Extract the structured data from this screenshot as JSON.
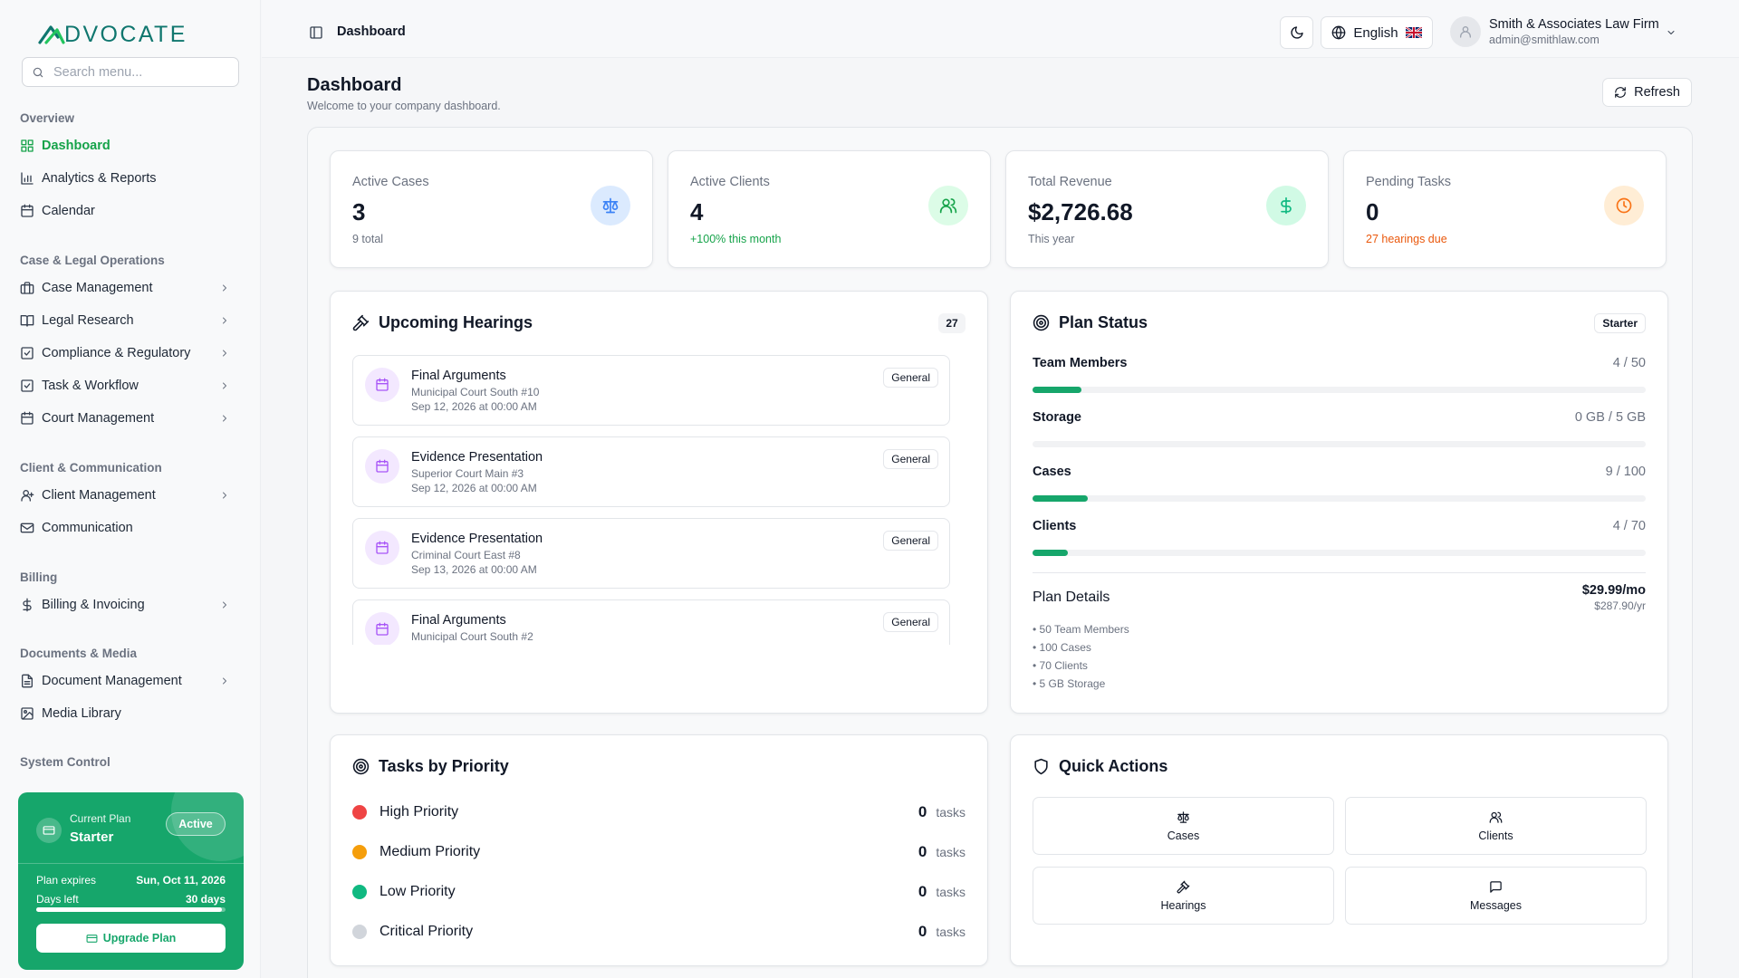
{
  "brand": {
    "name": "DVOCATE"
  },
  "search": {
    "placeholder": "Search menu..."
  },
  "nav": {
    "overview": "Overview",
    "dashboard": "Dashboard",
    "analytics": "Analytics & Reports",
    "calendar": "Calendar",
    "case_ops": "Case & Legal Operations",
    "case_mgmt": "Case Management",
    "legal_research": "Legal Research",
    "compliance": "Compliance & Regulatory",
    "task_workflow": "Task & Workflow",
    "court_mgmt": "Court Management",
    "client_comm": "Client & Communication",
    "client_mgmt": "Client Management",
    "communication": "Communication",
    "billing_section": "Billing",
    "billing": "Billing & Invoicing",
    "documents_section": "Documents & Media",
    "document_mgmt": "Document Management",
    "media": "Media Library",
    "system": "System Control"
  },
  "plan_card": {
    "label": "Current Plan",
    "name": "Starter",
    "status": "Active",
    "expires_label": "Plan expires",
    "expires_value": "Sun, Oct 11, 2026",
    "days_label": "Days left",
    "days_value": "30 days",
    "days_progress": 0.98,
    "upgrade": "Upgrade Plan"
  },
  "topbar": {
    "title": "Dashboard",
    "language": "English",
    "user_name": "Smith & Associates Law Firm",
    "user_email": "admin@smithlaw.com"
  },
  "page": {
    "title": "Dashboard",
    "subtitle": "Welcome to your company dashboard.",
    "refresh": "Refresh"
  },
  "stats": [
    {
      "label": "Active Cases",
      "value": "3",
      "sub": "9 total",
      "icon": "scale-icon",
      "color": "#3b82f6",
      "bg": "#dbeafe",
      "sub_color": "#6b7280"
    },
    {
      "label": "Active Clients",
      "value": "4",
      "sub": "+100% this month",
      "icon": "users-icon",
      "color": "#16a34a",
      "bg": "#dcfce7",
      "sub_color": "#16a34a"
    },
    {
      "label": "Total Revenue",
      "value": "$2,726.68",
      "sub": "This year",
      "icon": "dollar-icon",
      "color": "#10b981",
      "bg": "#d1fae5",
      "sub_color": "#6b7280"
    },
    {
      "label": "Pending Tasks",
      "value": "0",
      "sub": "27 hearings due",
      "icon": "clock-icon",
      "color": "#f97316",
      "bg": "#ffedd5",
      "sub_color": "#ea580c"
    }
  ],
  "hearings": {
    "title": "Upcoming Hearings",
    "count": "27",
    "items": [
      {
        "title": "Final Arguments",
        "court": "Municipal Court South #10",
        "date": "Sep 12, 2026 at 00:00 AM",
        "tag": "General"
      },
      {
        "title": "Evidence Presentation",
        "court": "Superior Court Main #3",
        "date": "Sep 12, 2026 at 00:00 AM",
        "tag": "General"
      },
      {
        "title": "Evidence Presentation",
        "court": "Criminal Court East #8",
        "date": "Sep 13, 2026 at 00:00 AM",
        "tag": "General"
      },
      {
        "title": "Final Arguments",
        "court": "Municipal Court South #2",
        "date": "",
        "tag": "General"
      }
    ]
  },
  "plan_status": {
    "title": "Plan Status",
    "badge": "Starter",
    "rows": [
      {
        "label": "Team Members",
        "value": "4 / 50",
        "fraction": 0.08
      },
      {
        "label": "Storage",
        "value": "0 GB / 5 GB",
        "fraction": 0
      },
      {
        "label": "Cases",
        "value": "9 / 100",
        "fraction": 0.09
      },
      {
        "label": "Clients",
        "value": "4 / 70",
        "fraction": 0.057
      }
    ],
    "details_title": "Plan Details",
    "price_month": "$29.99/mo",
    "price_year": "$287.90/yr",
    "features": [
      "• 50 Team Members",
      "• 100 Cases",
      "• 70 Clients",
      "• 5 GB Storage"
    ]
  },
  "tasks": {
    "title": "Tasks by Priority",
    "items": [
      {
        "label": "High Priority",
        "count": "0",
        "unit": "tasks",
        "color": "#ef4444"
      },
      {
        "label": "Medium Priority",
        "count": "0",
        "unit": "tasks",
        "color": "#f59e0b"
      },
      {
        "label": "Low Priority",
        "count": "0",
        "unit": "tasks",
        "color": "#10b981"
      },
      {
        "label": "Critical Priority",
        "count": "0",
        "unit": "tasks",
        "color": "#d1d5db"
      }
    ]
  },
  "quick_actions": {
    "title": "Quick Actions",
    "items": [
      {
        "label": "Cases",
        "icon": "scale-icon"
      },
      {
        "label": "Clients",
        "icon": "users-icon"
      },
      {
        "label": "Hearings",
        "icon": "gavel-icon"
      },
      {
        "label": "Messages",
        "icon": "message-icon"
      }
    ]
  }
}
